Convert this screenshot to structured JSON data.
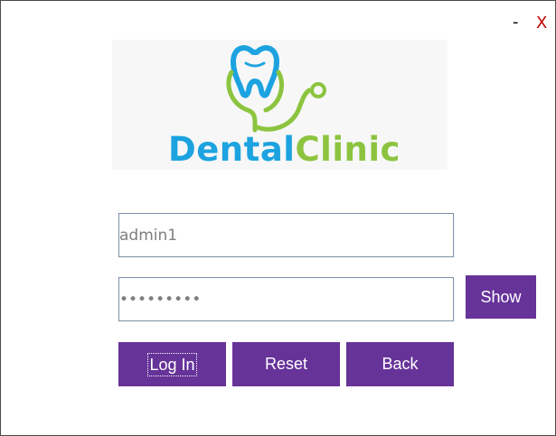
{
  "window": {
    "minimize_label": "-",
    "close_label": "X"
  },
  "logo": {
    "text_part1": "Dental",
    "text_part2": "Clinic"
  },
  "form": {
    "username_value": "admin1",
    "password_value": "•••••••••"
  },
  "buttons": {
    "show_label": "Show",
    "login_label": "Log In",
    "reset_label": "Reset",
    "back_label": "Back"
  },
  "colors": {
    "button_bg": "#663399",
    "close": "#c00000",
    "logo_blue": "#1ca3e0",
    "logo_green": "#8cc43f"
  }
}
